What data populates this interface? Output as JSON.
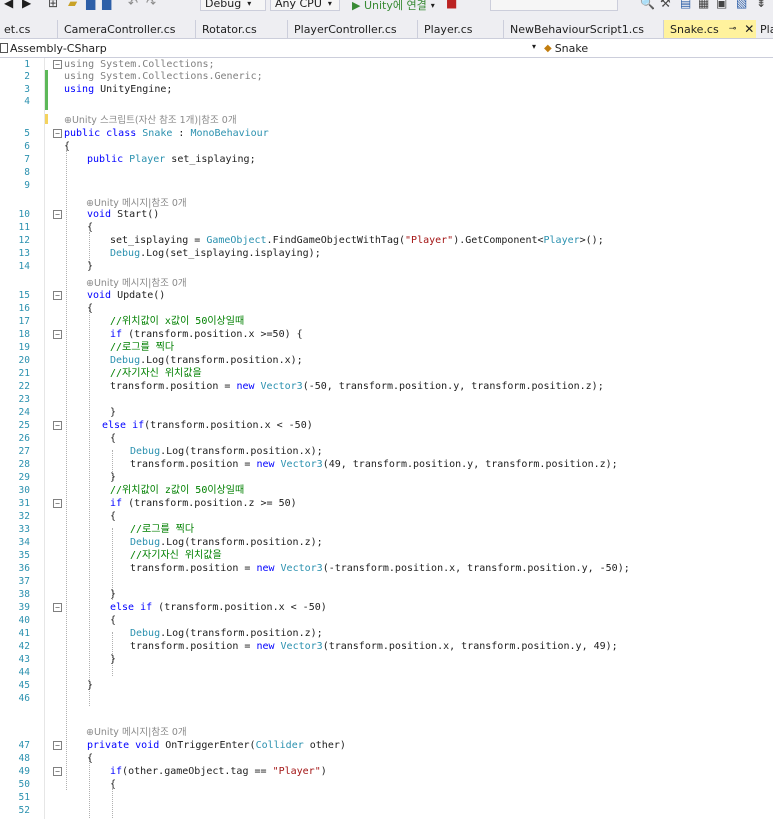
{
  "toolbar": {
    "config": "Debug",
    "platform": "Any CPU",
    "run_label": "▶ Unity에 연결"
  },
  "tabs": [
    {
      "label": "et.cs"
    },
    {
      "label": "CameraController.cs"
    },
    {
      "label": "Rotator.cs"
    },
    {
      "label": "PlayerController.cs"
    },
    {
      "label": "Player.cs"
    },
    {
      "label": "NewBehaviourScript1.cs"
    },
    {
      "label": "Snake.cs",
      "active": true
    },
    {
      "label": "Play"
    }
  ],
  "navbar": {
    "project": "Assembly-CSharp",
    "class_member": "Snake"
  },
  "code_lens": {
    "class_refs": "⊕Unity 스크립트(자산 참조 1개)|참조 0개",
    "method_refs": "⊕Unity 메시지|참조 0개"
  },
  "code_lines": [
    {
      "n": "1",
      "text": "using System.Collections;"
    },
    {
      "n": "2",
      "text": "using System.Collections.Generic;"
    },
    {
      "n": "3",
      "text": "using UnityEngine;"
    },
    {
      "n": "4",
      "text": ""
    },
    {
      "n": "5",
      "text": "public class Snake : MonoBehaviour"
    },
    {
      "n": "6",
      "text": "{"
    },
    {
      "n": "7",
      "text": "public Player set_isplaying;"
    },
    {
      "n": "8",
      "text": ""
    },
    {
      "n": "9",
      "text": ""
    },
    {
      "n": "10",
      "text": "void Start()"
    },
    {
      "n": "11",
      "text": "{"
    },
    {
      "n": "12",
      "text": "set_isplaying = GameObject.FindGameObjectWithTag(\"Player\").GetComponent<Player>();"
    },
    {
      "n": "13",
      "text": "Debug.Log(set_isplaying.isplaying);"
    },
    {
      "n": "14",
      "text": "}"
    },
    {
      "n": "15",
      "text": "void Update()"
    },
    {
      "n": "16",
      "text": "{"
    },
    {
      "n": "17",
      "text": "//위치값이 x값이 50이상일때"
    },
    {
      "n": "18",
      "text": "if (transform.position.x >=50) {"
    },
    {
      "n": "19",
      "text": "//로그를 찍다"
    },
    {
      "n": "20",
      "text": "Debug.Log(transform.position.x);"
    },
    {
      "n": "21",
      "text": "//자기자신 위치값을"
    },
    {
      "n": "22",
      "text": "transform.position = new Vector3(-50, transform.position.y, transform.position.z);"
    },
    {
      "n": "23",
      "text": ""
    },
    {
      "n": "24",
      "text": "}"
    },
    {
      "n": "25",
      "text": "else if(transform.position.x < -50)"
    },
    {
      "n": "26",
      "text": "{"
    },
    {
      "n": "27",
      "text": "Debug.Log(transform.position.x);"
    },
    {
      "n": "28",
      "text": "transform.position = new Vector3(49, transform.position.y, transform.position.z);"
    },
    {
      "n": "29",
      "text": "}"
    },
    {
      "n": "30",
      "text": "//위치값이 z값이 50이상일때"
    },
    {
      "n": "31",
      "text": "if (transform.position.z >= 50)"
    },
    {
      "n": "32",
      "text": "{"
    },
    {
      "n": "33",
      "text": "//로그를 찍다"
    },
    {
      "n": "34",
      "text": "Debug.Log(transform.position.z);"
    },
    {
      "n": "35",
      "text": "//자기자신 위치값을"
    },
    {
      "n": "36",
      "text": "transform.position = new Vector3(-transform.position.x, transform.position.y, -50);"
    },
    {
      "n": "37",
      "text": ""
    },
    {
      "n": "38",
      "text": "}"
    },
    {
      "n": "39",
      "text": "else if (transform.position.x < -50)"
    },
    {
      "n": "40",
      "text": "{"
    },
    {
      "n": "41",
      "text": "Debug.Log(transform.position.z);"
    },
    {
      "n": "42",
      "text": "transform.position = new Vector3(transform.position.x, transform.position.y, 49);"
    },
    {
      "n": "43",
      "text": "}"
    },
    {
      "n": "44",
      "text": ""
    },
    {
      "n": "45",
      "text": "}"
    },
    {
      "n": "46",
      "text": ""
    },
    {
      "n": "47",
      "text": "private void OnTriggerEnter(Collider other)"
    },
    {
      "n": "48",
      "text": "{"
    },
    {
      "n": "49",
      "text": "if(other.gameObject.tag == \"Player\")"
    },
    {
      "n": "50",
      "text": "{"
    },
    {
      "n": "51",
      "text": ""
    },
    {
      "n": "52",
      "text": ""
    }
  ],
  "colors": {
    "keyword": "#0000ff",
    "type": "#2b91af",
    "comment": "#008000",
    "string": "#a31515",
    "line_number": "#2b91af",
    "active_tab": "#fff29d"
  }
}
